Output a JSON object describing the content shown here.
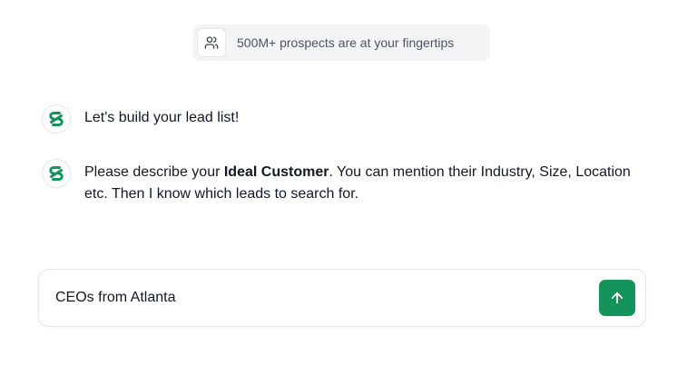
{
  "banner": {
    "icon": "users-icon",
    "text": "500M+ prospects are at your fingertips"
  },
  "messages": [
    {
      "avatar_icon": "brand-logo-icon",
      "text": "Let's build your lead list!"
    },
    {
      "avatar_icon": "brand-logo-icon",
      "text_before": "Please describe your ",
      "text_bold": "Ideal Customer",
      "text_after": ". You can mention their Industry, Size, Location etc. Then I know which leads to search for."
    }
  ],
  "composer": {
    "value": "CEOs from Atlanta",
    "send_icon": "arrow-up-icon"
  },
  "colors": {
    "accent": "#14935a",
    "pill_bg": "#f3f4f6",
    "muted_text": "#4b5563"
  }
}
